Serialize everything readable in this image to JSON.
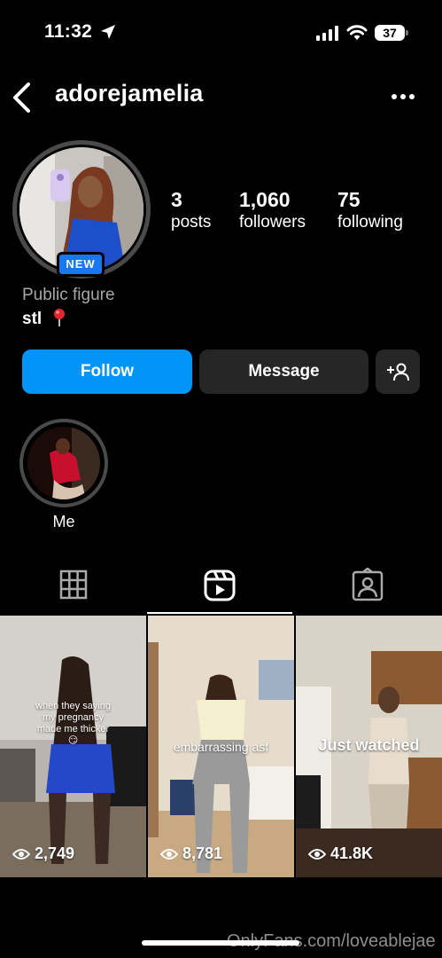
{
  "status_bar": {
    "time": "11:32",
    "battery": "37"
  },
  "header": {
    "username": "adorejamelia"
  },
  "profile": {
    "badge": "NEW",
    "stats": [
      {
        "value": "3",
        "label": "posts"
      },
      {
        "value": "1,060",
        "label": "followers"
      },
      {
        "value": "75",
        "label": "following"
      }
    ],
    "category": "Public figure",
    "bio": "stl"
  },
  "actions": {
    "follow": "Follow",
    "message": "Message"
  },
  "highlights": [
    {
      "label": "Me"
    }
  ],
  "reels": [
    {
      "caption": "when they saying my pregnancy made me thicker 😏",
      "views": "2,749"
    },
    {
      "caption": "embarrassing asf",
      "views": "8,781"
    },
    {
      "caption": "Just watched",
      "views": "41.8K"
    }
  ],
  "watermark": "OnlyFans.com/loveablejae",
  "colors": {
    "follow_blue": "#0095f6",
    "button_gray": "#262626",
    "badge_blue": "#1877f2"
  }
}
